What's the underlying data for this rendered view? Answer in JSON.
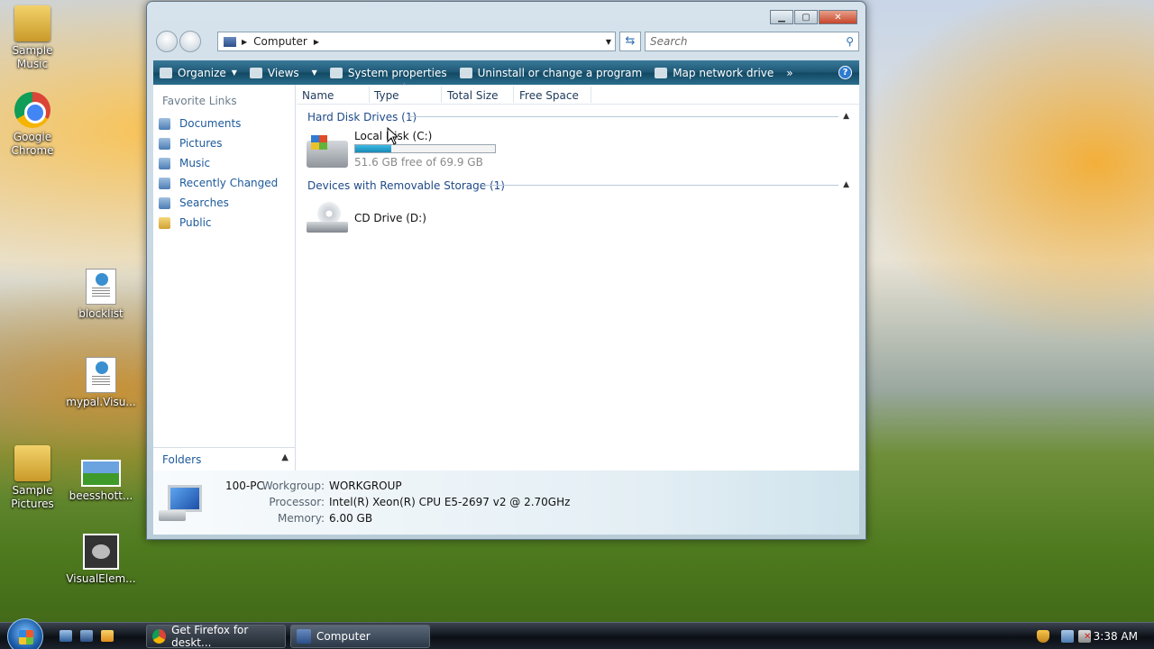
{
  "desktop": {
    "icons": [
      {
        "label_1": "Sample",
        "label_2": "Music"
      },
      {
        "label_1": "Google",
        "label_2": "Chrome"
      },
      {
        "label_1": "blocklist",
        "label_2": ""
      },
      {
        "label_1": "mypal.Visu...",
        "label_2": ""
      },
      {
        "label_1": "Sample",
        "label_2": "Pictures"
      },
      {
        "label_1": "beesshott...",
        "label_2": ""
      },
      {
        "label_1": "VisualElem...",
        "label_2": ""
      }
    ]
  },
  "window": {
    "address": "Computer",
    "search_placeholder": "Search",
    "toolbar": {
      "organize": "Organize",
      "views": "Views",
      "system_properties": "System properties",
      "uninstall": "Uninstall or change a program",
      "map_drive": "Map network drive",
      "more": "»",
      "help": "?"
    },
    "favorites": {
      "title": "Favorite Links",
      "items": [
        "Documents",
        "Pictures",
        "Music",
        "Recently Changed",
        "Searches",
        "Public"
      ]
    },
    "folders_label": "Folders",
    "columns": [
      "Name",
      "Type",
      "Total Size",
      "Free Space"
    ],
    "groups": [
      {
        "title": "Hard Disk Drives (1)"
      },
      {
        "title": "Devices with Removable Storage (1)"
      }
    ],
    "drives": [
      {
        "name": "Local Disk (C:)",
        "free_text": "51.6 GB free of 69.9 GB",
        "used_fraction": 0.26
      },
      {
        "name": "CD Drive (D:)"
      }
    ],
    "details": {
      "computer_name": "100-PC",
      "workgroup_label": "Workgroup:",
      "workgroup": "WORKGROUP",
      "processor_label": "Processor:",
      "processor": "Intel(R) Xeon(R) CPU E5-2697 v2 @ 2.70GHz",
      "memory_label": "Memory:",
      "memory": "6.00 GB"
    }
  },
  "taskbar": {
    "tasks": [
      "Get Firefox for deskt...",
      "Computer"
    ],
    "clock": "3:38 AM"
  }
}
